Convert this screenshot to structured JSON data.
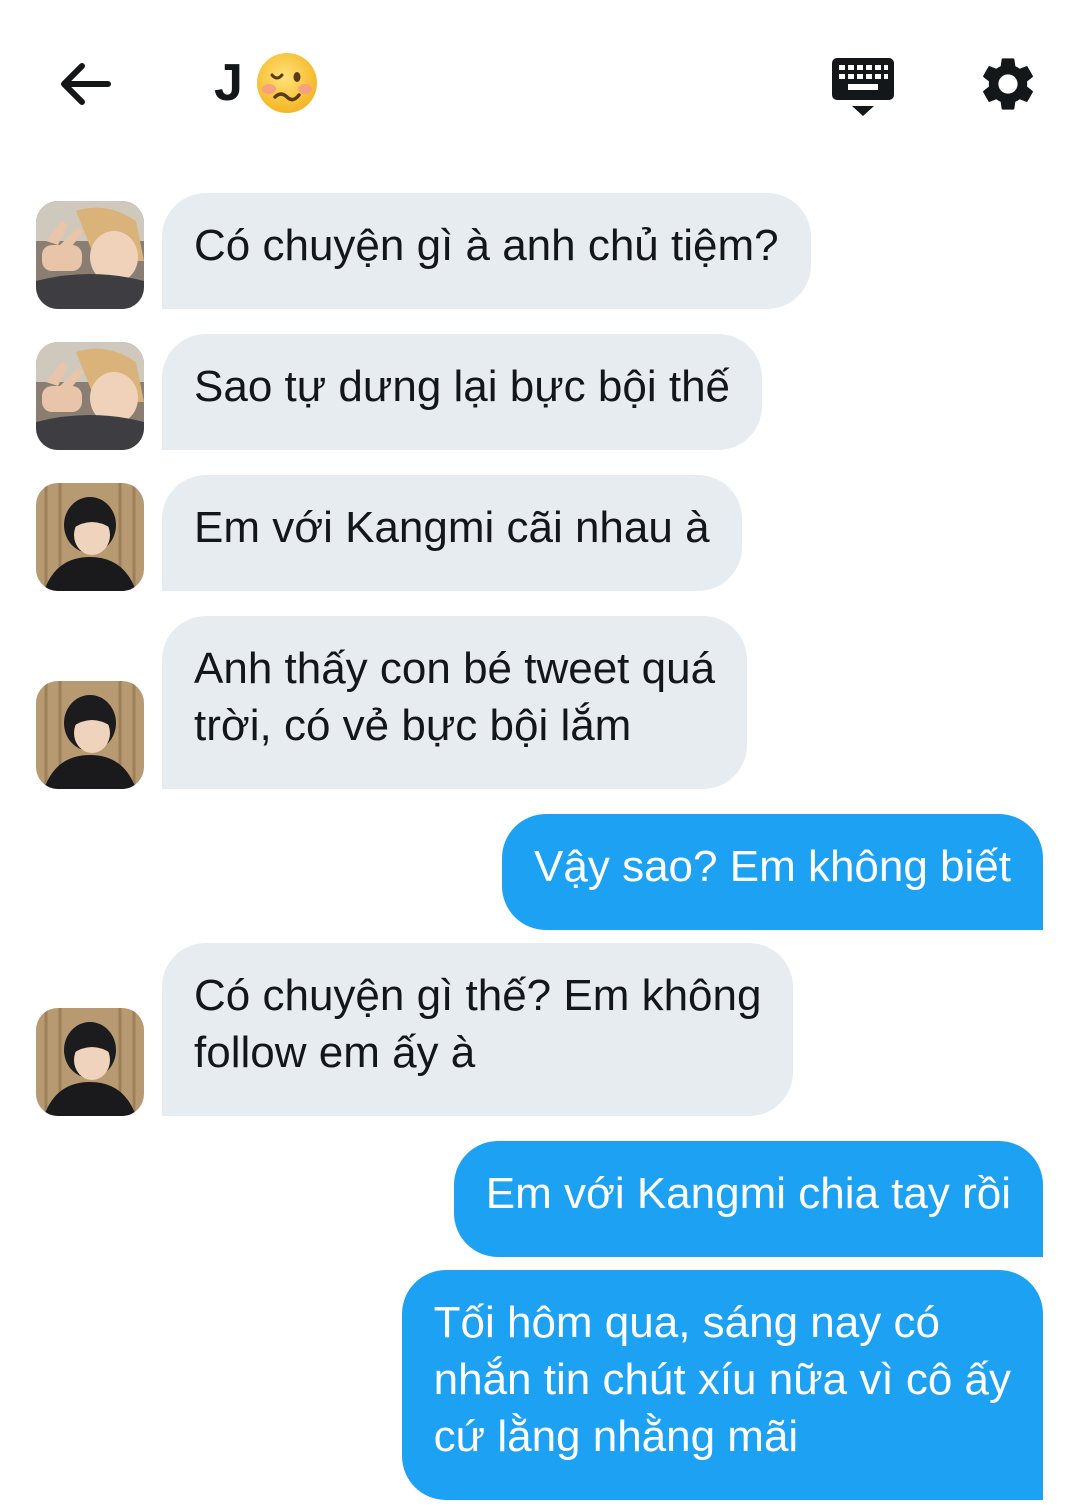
{
  "header": {
    "title": "J",
    "title_emoji": "woozy-face-emoji",
    "back_icon": "arrow-left-icon",
    "keyboard_icon": "keyboard-icon",
    "settings_icon": "gear-icon"
  },
  "colors": {
    "incoming_bubble": "#e6ecf0",
    "outgoing_bubble": "#1da1f2",
    "text": "#14171a"
  },
  "messages": [
    {
      "direction": "incoming",
      "avatar": "avatar-blond",
      "text": "Có chuyện gì à anh chủ tiệm?"
    },
    {
      "direction": "incoming",
      "avatar": "avatar-blond",
      "text": "Sao tự dưng lại bực bội thế"
    },
    {
      "direction": "incoming",
      "avatar": "avatar-dark",
      "text": "Em với Kangmi cãi nhau à"
    },
    {
      "direction": "incoming",
      "avatar": "avatar-dark",
      "text": "Anh thấy con bé tweet quá\ntrời, có vẻ bực bội lắm"
    },
    {
      "direction": "outgoing",
      "text": "Vậy sao? Em không biết"
    },
    {
      "direction": "incoming",
      "avatar": "avatar-dark",
      "text": "Có chuyện gì thế? Em không\nfollow em ấy à"
    },
    {
      "direction": "outgoing",
      "text": "Em với Kangmi chia tay rồi"
    },
    {
      "direction": "outgoing",
      "text": "Tối hôm qua, sáng nay có\nnhắn tin chút xíu nữa vì cô ấy\ncứ lằng nhằng mãi"
    }
  ]
}
